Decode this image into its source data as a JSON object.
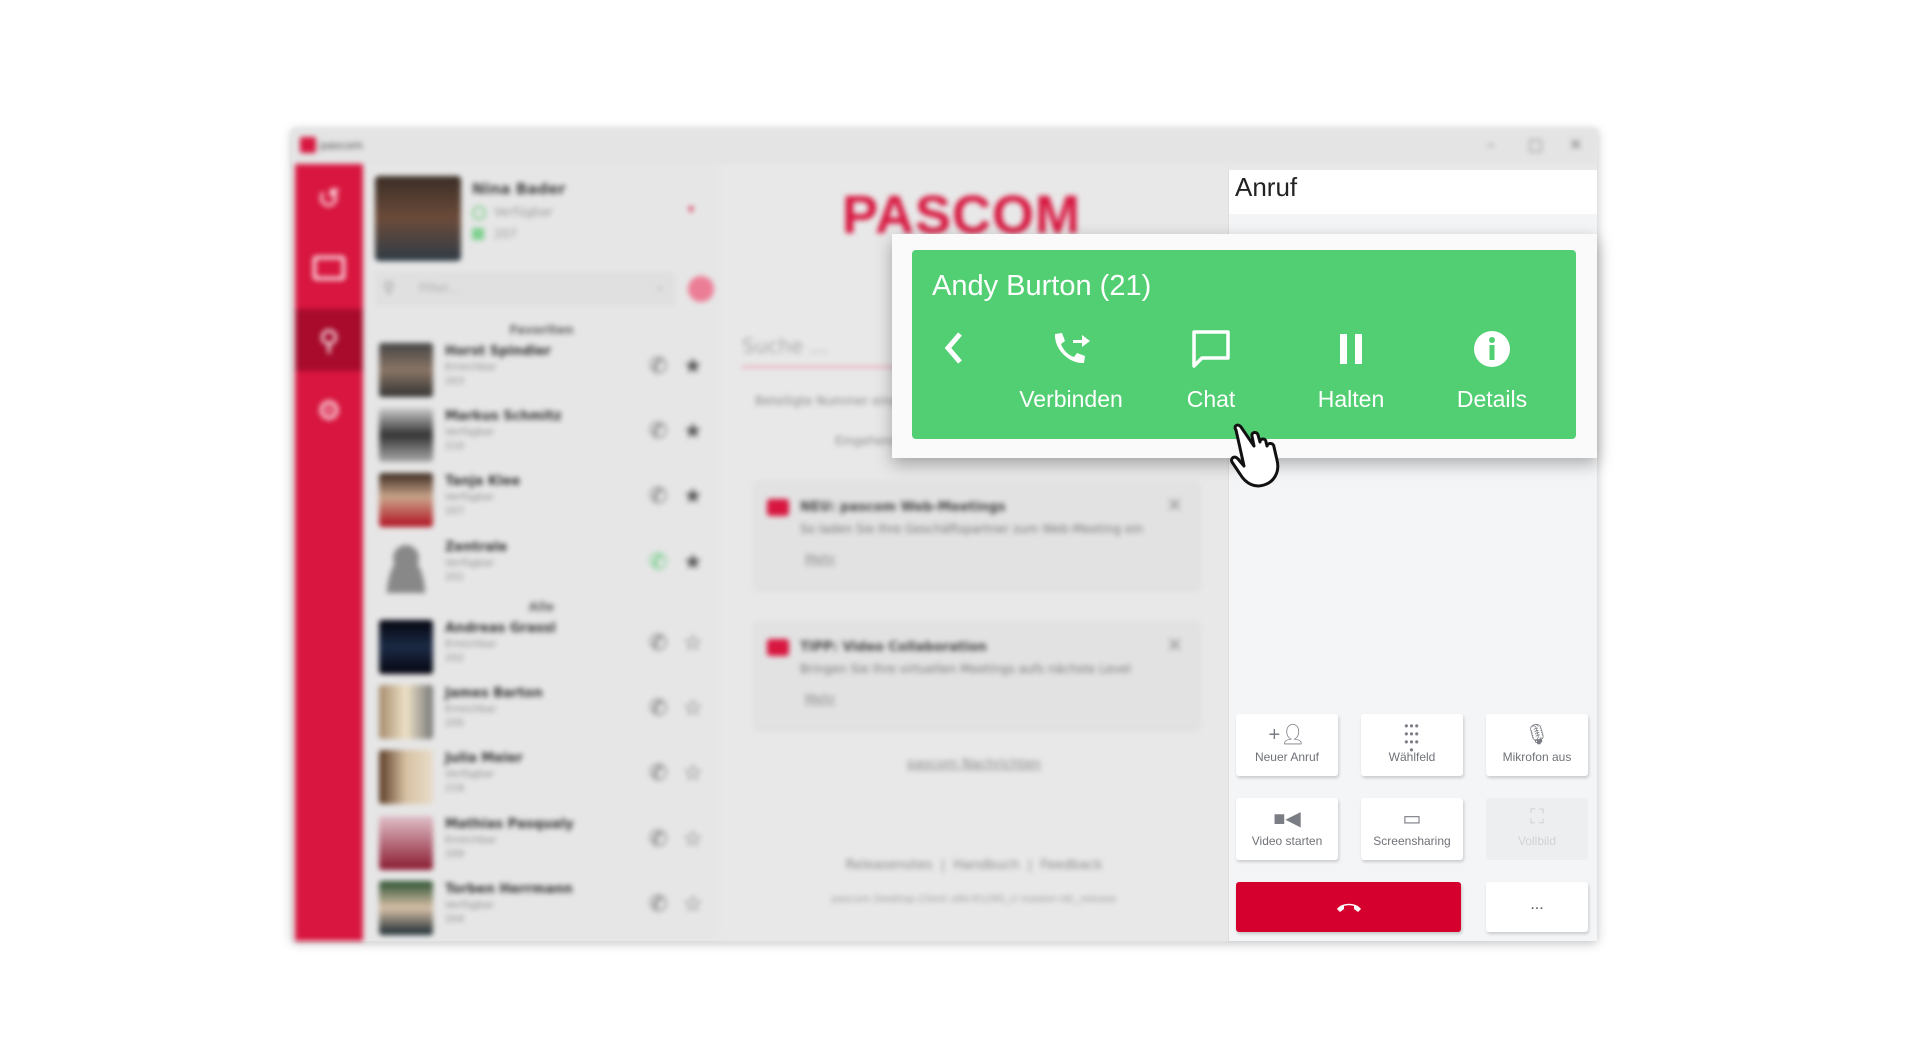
{
  "app": {
    "title": "pascom",
    "brand_color": "#d8163f",
    "logo_text": "PASCOM"
  },
  "window_controls": [
    "minimize-icon",
    "maximize-icon",
    "close-icon"
  ],
  "sidebar": {
    "items": [
      {
        "icon": "history-icon"
      },
      {
        "icon": "contacts-icon"
      },
      {
        "icon": "search-icon",
        "active": true
      },
      {
        "icon": "gear-icon"
      }
    ]
  },
  "profile": {
    "name": "Nina Bader",
    "status": "Verfügbar",
    "extension": "207"
  },
  "filter": {
    "placeholder": "Filter..."
  },
  "contacts": {
    "favorites_label": "Favoriten",
    "all_label": "Alle",
    "favorites": [
      {
        "name": "Horst Spindler",
        "status": "Erreichbar",
        "ext": "203"
      },
      {
        "name": "Markus Schmitz",
        "status": "Verfügbar",
        "ext": "210"
      },
      {
        "name": "Tanja Klee",
        "status": "Verfügbar",
        "ext": "207"
      },
      {
        "name": "Zentrale",
        "status": "Verfügbar",
        "ext": "201"
      }
    ],
    "all": [
      {
        "name": "Andreas Grassl",
        "status": "Erreichbar",
        "ext": "202"
      },
      {
        "name": "James Barton",
        "status": "Erreichbar",
        "ext": "205"
      },
      {
        "name": "Julia Meier",
        "status": "Verfügbar",
        "ext": "218"
      },
      {
        "name": "Mathias Pasqualy",
        "status": "Erreichbar",
        "ext": "209"
      },
      {
        "name": "Torben Herrmann",
        "status": "Verfügbar",
        "ext": "204"
      }
    ]
  },
  "middle": {
    "search_placeholder": "Suche ...",
    "hint": "Beteiligte Nummer eingeben",
    "sub": "Eingehende",
    "cards": [
      {
        "title": "NEU: pascom Web-Meetings",
        "body": "So laden Sie Ihre Geschäftspartner zum Web-Meeting ein",
        "more": "Mehr"
      },
      {
        "title": "TIPP: Video Collaboration",
        "body": "Bringen Sie Ihre virtuellen Meetings aufs nächste Level",
        "more": "Mehr"
      }
    ],
    "news_link": "pascom Nachrichten",
    "links": [
      "Releasenotes",
      "|",
      "Handbuch",
      "|",
      "Feedback"
    ],
    "version": "pascom Desktop Client v84.R1295_ci master-rdc_release"
  },
  "call_panel": {
    "title": "Anruf",
    "actions": [
      {
        "label": "Neuer Anruf",
        "icon": "add-person-icon"
      },
      {
        "label": "Wählfeld",
        "icon": "dialpad-icon"
      },
      {
        "label": "Mikrofon aus",
        "icon": "microphone-icon"
      },
      {
        "label": "Video starten",
        "icon": "video-camera-icon"
      },
      {
        "label": "Screensharing",
        "icon": "screen-share-icon"
      },
      {
        "label": "Vollbild",
        "icon": "fullscreen-icon",
        "disabled": true
      }
    ],
    "hangup_icon": "hangup-icon",
    "more_label": "..."
  },
  "call_popup": {
    "caller": "Andy Burton (21)",
    "color": "#52cf72",
    "buttons": [
      {
        "label": "Verbinden",
        "icon": "transfer-call-icon"
      },
      {
        "label": "Chat",
        "icon": "chat-bubble-icon"
      },
      {
        "label": "Halten",
        "icon": "pause-icon"
      },
      {
        "label": "Details",
        "icon": "info-icon"
      }
    ]
  }
}
